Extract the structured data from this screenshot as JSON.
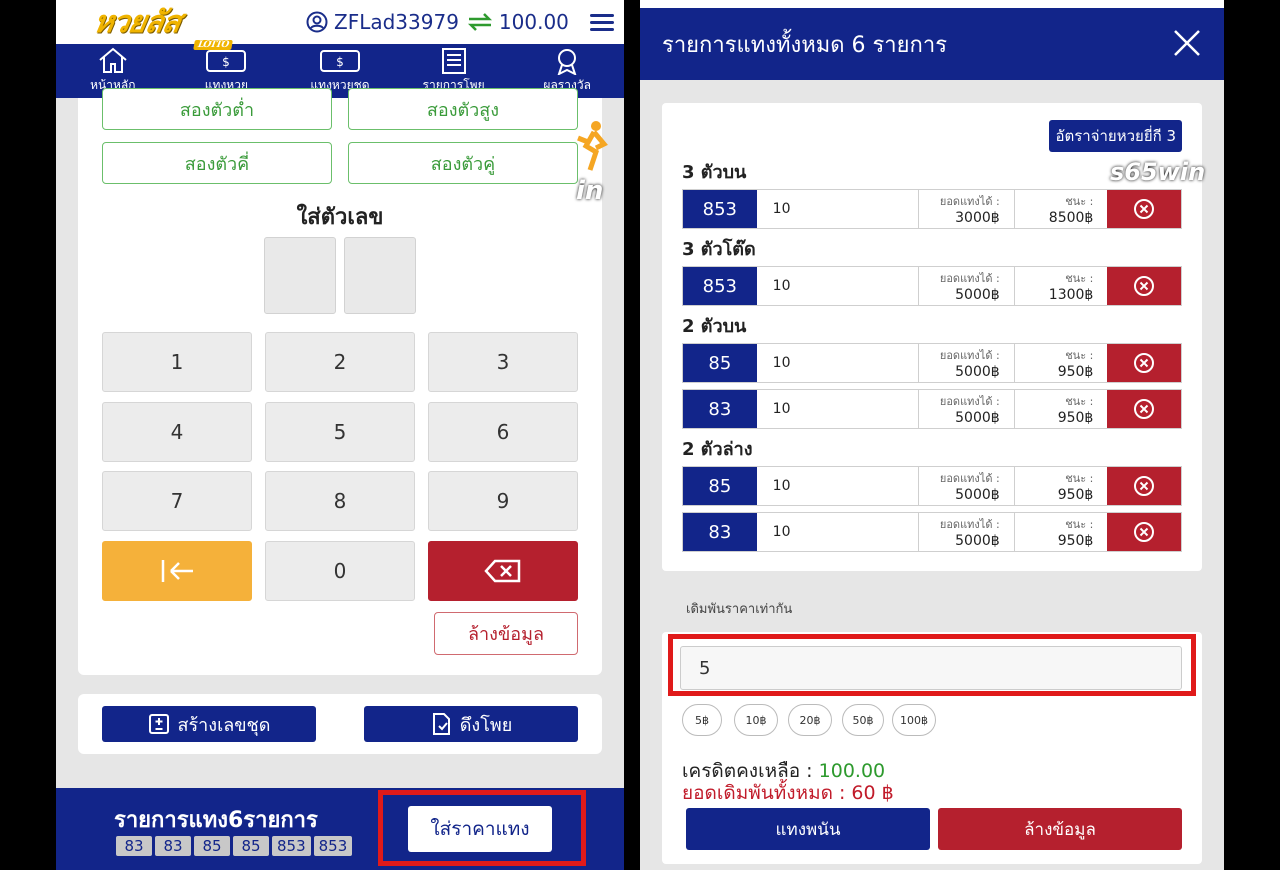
{
  "left": {
    "logo": {
      "text": "หวยลัส",
      "sub": "LOTTO"
    },
    "username": "ZFLad33979",
    "balance": "100.00",
    "nav": [
      {
        "label": "หน้าหลัก",
        "icon": "home-icon"
      },
      {
        "label": "แทงหวย",
        "icon": "ticket-icon"
      },
      {
        "label": "แทงหวยชุด",
        "icon": "ticket-set-icon"
      },
      {
        "label": "รายการโพย",
        "icon": "list-icon"
      },
      {
        "label": "ผลรางวัล",
        "icon": "award-icon"
      }
    ],
    "options": [
      "สองตัวต่ำ",
      "สองตัวสูง",
      "สองตัวคี่",
      "สองตัวคู่"
    ],
    "enter_title": "ใส่ตัวเลข",
    "keys": [
      "1",
      "2",
      "3",
      "4",
      "5",
      "6",
      "7",
      "8",
      "9",
      "0"
    ],
    "clear_label": "ล้างข้อมูล",
    "create_set_label": "สร้างเลขชุด",
    "pull_slip_label": "ดึงโพย",
    "bottom_title": "รายการแทง6รายการ",
    "bottom_chips": [
      "83",
      "83",
      "85",
      "85",
      "853",
      "853"
    ],
    "place_price_label": "ใส่ราคาแทง",
    "watermark": "in"
  },
  "right": {
    "title": "รายการแทงทั้งหมด 6 รายการ",
    "rate_label": "อัตราจ่ายหวยยี่กี 3",
    "can_bet_label": "ยอดแทงได้ :",
    "win_label": "ชนะ :",
    "groups": [
      {
        "title": "3 ตัวบน",
        "rows": [
          {
            "number": "853",
            "amount": "10",
            "can_bet": "3000฿",
            "win": "8500฿"
          }
        ]
      },
      {
        "title": "3 ตัวโต๊ด",
        "rows": [
          {
            "number": "853",
            "amount": "10",
            "can_bet": "5000฿",
            "win": "1300฿"
          }
        ]
      },
      {
        "title": "2 ตัวบน",
        "rows": [
          {
            "number": "85",
            "amount": "10",
            "can_bet": "5000฿",
            "win": "950฿"
          },
          {
            "number": "83",
            "amount": "10",
            "can_bet": "5000฿",
            "win": "950฿"
          }
        ]
      },
      {
        "title": "2 ตัวล่าง",
        "rows": [
          {
            "number": "85",
            "amount": "10",
            "can_bet": "5000฿",
            "win": "950฿"
          },
          {
            "number": "83",
            "amount": "10",
            "can_bet": "5000฿",
            "win": "950฿"
          }
        ]
      }
    ],
    "same_price_label": "เดิมพันราคาเท่ากัน",
    "amount_value": "5",
    "quick_amounts": [
      "5฿",
      "10฿",
      "20฿",
      "50฿",
      "100฿"
    ],
    "credit_label": "เครดิตคงเหลือ :",
    "credit_value": "100.00",
    "total_label": "ยอดเดิมพันทั้งหมด : 60 ฿",
    "bet_button": "แทงพนัน",
    "clear_button": "ล้างข้อมูล",
    "watermark": "s65win"
  },
  "colors": {
    "navy": "#12258a",
    "red": "#b5202e",
    "orange": "#f5b13a",
    "green": "#3a9b3a",
    "highlight": "#e01a1a"
  }
}
